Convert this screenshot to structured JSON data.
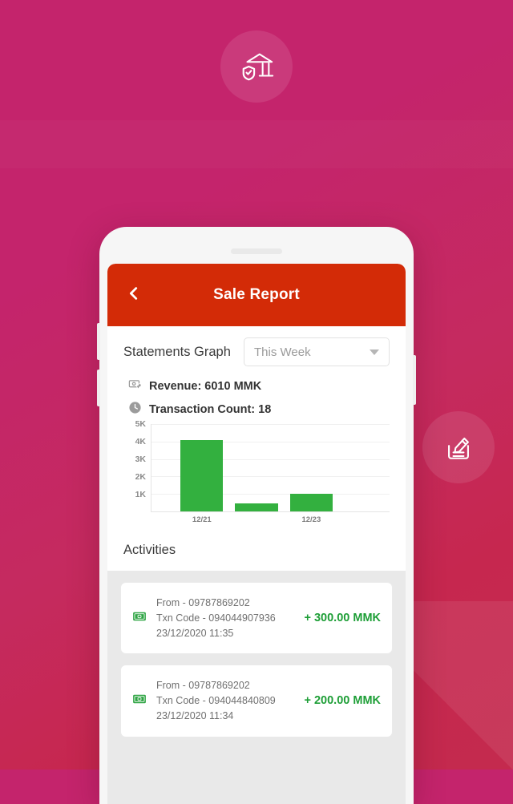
{
  "background": {
    "color_top": "#C4246C",
    "color_bottom": "#C42A4E",
    "accent_red": "#D32B07",
    "accent_green": "#33B03F"
  },
  "floating_icons": [
    {
      "name": "bank-verified-icon",
      "label": "bank-verified"
    },
    {
      "name": "edit-note-icon",
      "label": "edit-note"
    }
  ],
  "appbar": {
    "title": "Sale Report",
    "back_icon": "chevron-left-icon"
  },
  "report": {
    "statements_label": "Statements Graph",
    "period": {
      "value": "This Week",
      "placeholder": "This Week",
      "options": [
        "This Week"
      ]
    },
    "stats": [
      {
        "icon": "cash-location-icon",
        "text": "Revenue: 6010 MMK"
      },
      {
        "icon": "clock-icon",
        "text": "Transaction Count: 18"
      }
    ],
    "activities_title": "Activities"
  },
  "chart_data": {
    "type": "bar",
    "title": "Statements Graph",
    "xlabel": "",
    "ylabel": "",
    "categories": [
      "12/21",
      "",
      "12/23"
    ],
    "values": [
      4100,
      450,
      1000
    ],
    "ytick_labels": [
      "5K",
      "4K",
      "3K",
      "2K",
      "1K"
    ],
    "ytick_values": [
      5000,
      4000,
      3000,
      2000,
      1000
    ],
    "xtick_labels": [
      "12/21",
      "12/23"
    ],
    "ylim": [
      0,
      5000
    ],
    "grid": true,
    "legend": false,
    "bar_color": "#33B03F"
  },
  "activities": [
    {
      "icon": "banknote-icon",
      "from": "From - 09787869202",
      "txn": "Txn Code - 094044907936",
      "datetime": "23/12/2020 11:35",
      "amount": "+ 300.00 MMK"
    },
    {
      "icon": "banknote-icon",
      "from": "From - 09787869202",
      "txn": "Txn Code - 094044840809",
      "datetime": "23/12/2020 11:34",
      "amount": "+ 200.00 MMK"
    }
  ]
}
